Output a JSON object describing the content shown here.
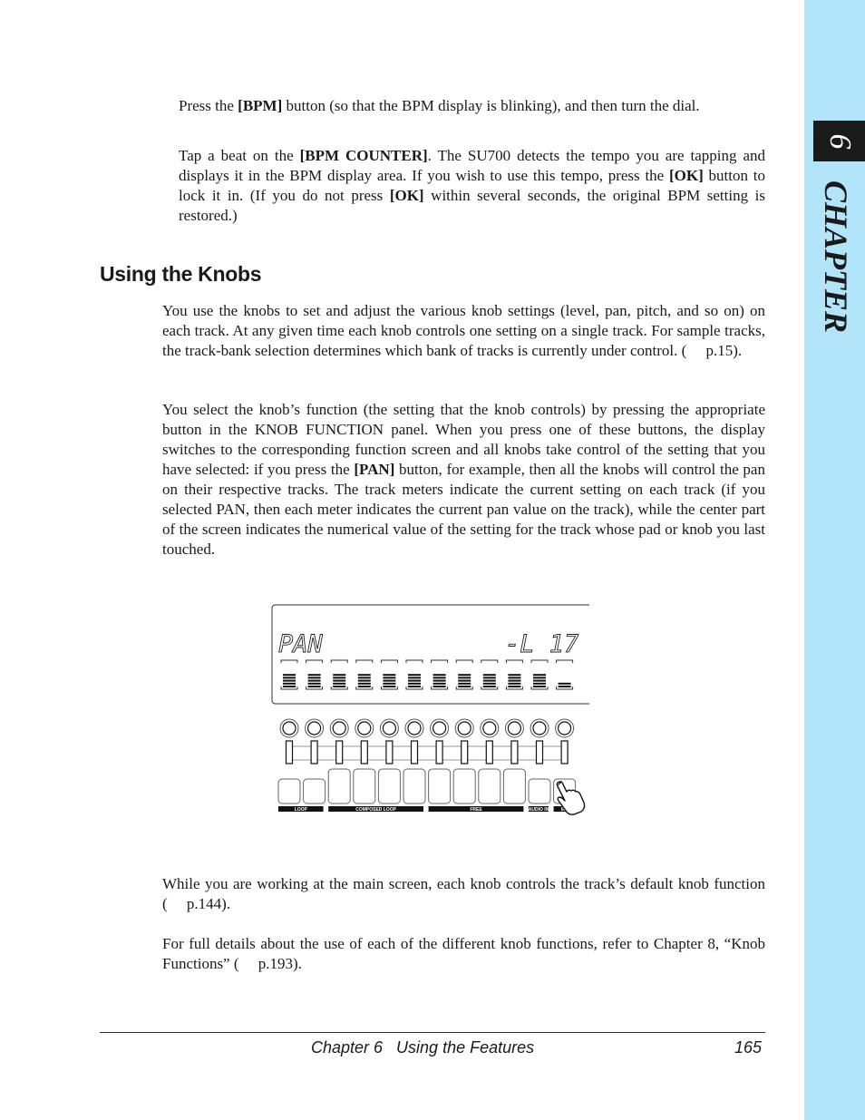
{
  "sidebar": {
    "chapter_word": "CHAPTER",
    "chapter_number": "6",
    "color": "#b3e5fa"
  },
  "intro": {
    "para1": {
      "a": "Press the ",
      "b1": "[BPM]",
      "c": " button (so that the BPM display is blinking), and then turn the dial."
    },
    "para2": {
      "a": "Tap a beat on the ",
      "b1": "[BPM COUNTER]",
      "c": ". The SU700 detects the tempo you are tapping and displays it in the BPM display area. If you wish to use this tempo, press the ",
      "b2": "[OK]",
      "d": " button to lock it in. (If you do not press ",
      "b3": "[OK]",
      "e": " within several seconds, the original BPM setting is restored.)"
    }
  },
  "section": {
    "heading": "Using the Knobs",
    "para1": "You use the knobs to set and adjust the various knob settings (level, pan, pitch, and so on) on each track. At any given time each knob controls one setting on a single track. For sample tracks, the track-bank selection determines which bank of tracks is currently under control. (  p.15).",
    "para2": {
      "a": "You select the knob’s function (the setting that the knob controls) by pressing the appropriate button in the KNOB FUNCTION panel. When you press one of these buttons, the display switches to the corresponding function screen and all knobs take control of the setting that you have selected: if you press the ",
      "b": "[PAN]",
      "c": " button, for example, then all the knobs will control the pan on their respective tracks. The track meters indicate the current setting on each track (if you selected PAN, then each meter indicates the current pan value on the track), while the center part of the screen indicates the numerical value of the setting for the track whose pad or knob you last touched."
    },
    "para3": "While you are working at the main screen, each knob controls the track’s default knob function (  p.144).",
    "para4": "For full details about the use of each of the different knob functions, refer to Chapter 8, “Knob Functions” (  p.193)."
  },
  "figure": {
    "lcd_function": "PAN",
    "lcd_value": "-L 17",
    "track_count": 12,
    "meter_levels": [
      5,
      5,
      5,
      5,
      5,
      5,
      5,
      5,
      5,
      5,
      5,
      2
    ],
    "groups": [
      "LOOP",
      "COMPOSED LOOP",
      "FREE",
      "AUDIO IN",
      "MA"
    ],
    "pointer_icon": "hand-pointer-icon"
  },
  "footer": {
    "title": "Chapter 6   Using the Features",
    "page": "165"
  }
}
